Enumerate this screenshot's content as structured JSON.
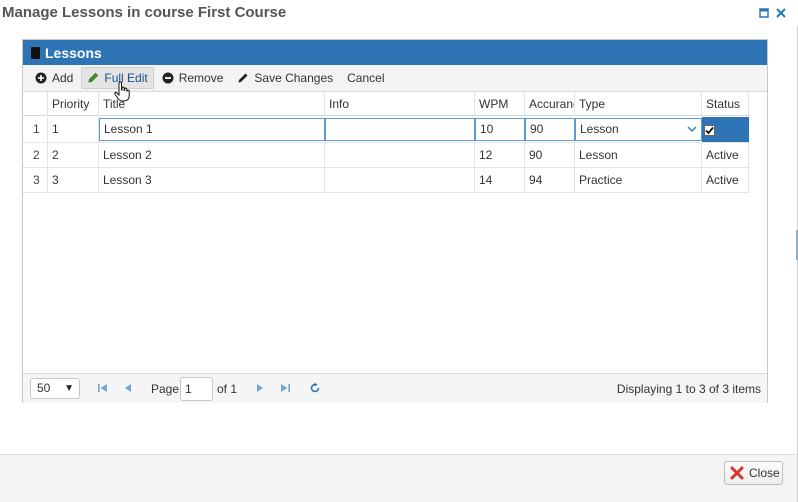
{
  "window": {
    "title": "Manage Lessons in course First Course",
    "close_label": "Close"
  },
  "panel": {
    "title": "Lessons"
  },
  "toolbar": {
    "add": "Add",
    "full_edit": "Full Edit",
    "remove": "Remove",
    "save_changes": "Save Changes",
    "cancel": "Cancel"
  },
  "grid": {
    "columns": [
      "Priority",
      "Title",
      "Info",
      "WPM",
      "Accuranc",
      "Type",
      "Status"
    ],
    "rows": [
      {
        "num": "1",
        "priority": "1",
        "title": "Lesson 1",
        "info": "",
        "wpm": "10",
        "accuracy": "90",
        "type": "Lesson",
        "status": ""
      },
      {
        "num": "2",
        "priority": "2",
        "title": "Lesson 2",
        "info": "",
        "wpm": "12",
        "accuracy": "90",
        "type": "Lesson",
        "status": "Active"
      },
      {
        "num": "3",
        "priority": "3",
        "title": "Lesson 3",
        "info": "",
        "wpm": "14",
        "accuracy": "94",
        "type": "Practice",
        "status": "Active"
      }
    ]
  },
  "pager": {
    "page_size": "50",
    "page_label": "Page",
    "page_value": "1",
    "of_label": "of 1",
    "info": "Displaying 1 to 3 of 3 items"
  },
  "colors": {
    "accent": "#2e74b5",
    "close_icon": "#d9342b"
  }
}
